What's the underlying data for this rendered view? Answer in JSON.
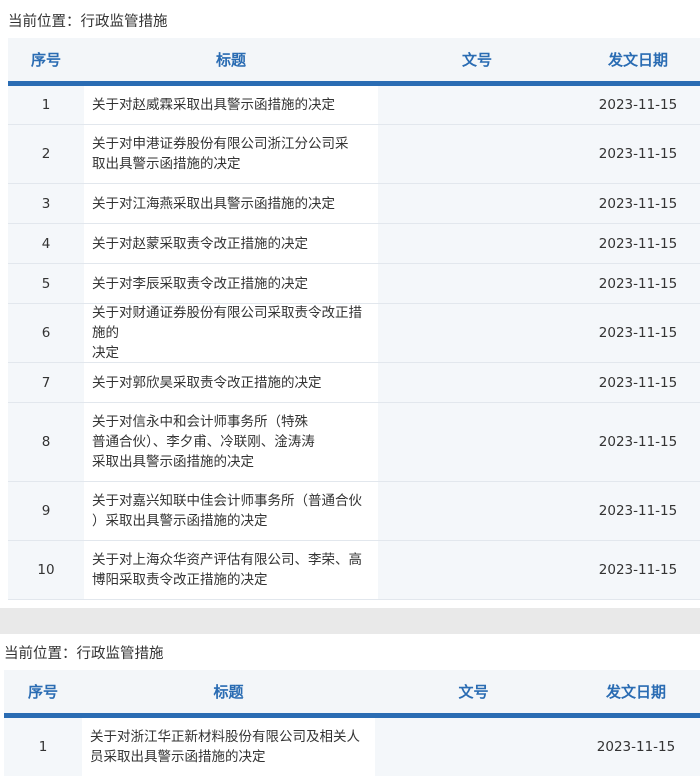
{
  "sections": [
    {
      "breadcrumb": "当前位置：行政监管措施",
      "headers": {
        "no": "序号",
        "title": "标题",
        "doc": "文号",
        "date": "发文日期"
      },
      "rows": [
        {
          "no": "1",
          "title": "关于对赵威霖采取出具警示函措施的决定",
          "doc": "",
          "date": "2023-11-15"
        },
        {
          "no": "2",
          "title": "关于对申港证券股份有限公司浙江分公司采取出具警示函措施的决定",
          "doc": "",
          "date": "2023-11-15"
        },
        {
          "no": "3",
          "title": "关于对江海燕采取出具警示函措施的决定",
          "doc": "",
          "date": "2023-11-15"
        },
        {
          "no": "4",
          "title": "关于对赵蒙采取责令改正措施的决定",
          "doc": "",
          "date": "2023-11-15"
        },
        {
          "no": "5",
          "title": "关于对李辰采取责令改正措施的决定",
          "doc": "",
          "date": "2023-11-15"
        },
        {
          "no": "6",
          "title": "关于对财通证券股份有限公司采取责令改正措施的决定",
          "doc": "",
          "date": "2023-11-15"
        },
        {
          "no": "7",
          "title": "关于对郭欣昊采取责令改正措施的决定",
          "doc": "",
          "date": "2023-11-15"
        },
        {
          "no": "8",
          "title": "关于对信永中和会计师事务所（特殊普通合伙）、李夕甫、冷联刚、淦涛涛采取出具警示函措施的决定",
          "doc": "",
          "date": "2023-11-15"
        },
        {
          "no": "9",
          "title": "关于对嘉兴知联中佳会计师事务所（普通合伙）采取出具警示函措施的决定",
          "doc": "",
          "date": "2023-11-15"
        },
        {
          "no": "10",
          "title": "关于对上海众华资产评估有限公司、李荣、高博阳采取责令改正措施的决定",
          "doc": "",
          "date": "2023-11-15"
        }
      ]
    },
    {
      "breadcrumb": "当前位置：行政监管措施",
      "headers": {
        "no": "序号",
        "title": "标题",
        "doc": "文号",
        "date": "发文日期"
      },
      "rows": [
        {
          "no": "1",
          "title": "关于对浙江华正新材料股份有限公司及相关人员采取出具警示函措施的决定",
          "doc": "",
          "date": "2023-11-15"
        }
      ]
    }
  ]
}
